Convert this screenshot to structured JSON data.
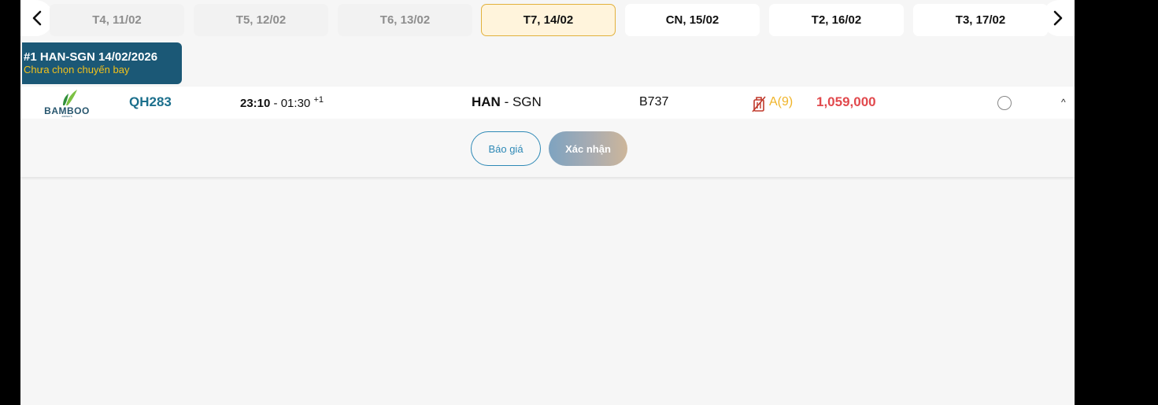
{
  "date_bar": {
    "prev_icon": "chevron-left-icon",
    "next_icon": "chevron-right-icon",
    "tabs": [
      {
        "label": "T4, 11/02",
        "state": "disabled"
      },
      {
        "label": "T5, 12/02",
        "state": "disabled"
      },
      {
        "label": "T6, 13/02",
        "state": "disabled"
      },
      {
        "label": "T7, 14/02",
        "state": "selected"
      },
      {
        "label": "CN, 15/02",
        "state": "available"
      },
      {
        "label": "T2, 16/02",
        "state": "available"
      },
      {
        "label": "T3, 17/02",
        "state": "available"
      }
    ]
  },
  "leg": {
    "title": "#1 HAN-SGN 14/02/2026",
    "status": "Chưa chọn chuyến bay"
  },
  "flight": {
    "airline_logo": "BAMBOO",
    "airline_logo_sub": "AIRWAYS",
    "flight_no": "QH283",
    "departure": "23:10",
    "separator": " - ",
    "arrival": "01:30",
    "day_offset": "+1",
    "origin": "HAN",
    "route_sep": " - ",
    "destination": "SGN",
    "aircraft": "B737",
    "baggage_icon": "no-baggage-icon",
    "fare_class": "A(9)",
    "price": "1,059,000",
    "selected": false
  },
  "actions": {
    "quote_label": "Báo giá",
    "confirm_label": "Xác nhận"
  },
  "colors": {
    "leg_label_bg": "#1b5876",
    "leg_status": "#f2c11b",
    "price": "#e1494d",
    "fare_class": "#f0b429",
    "flight_no": "#1b6f8c",
    "selected_tab_bg": "#fff4dc",
    "selected_tab_border": "#e2b13c"
  }
}
